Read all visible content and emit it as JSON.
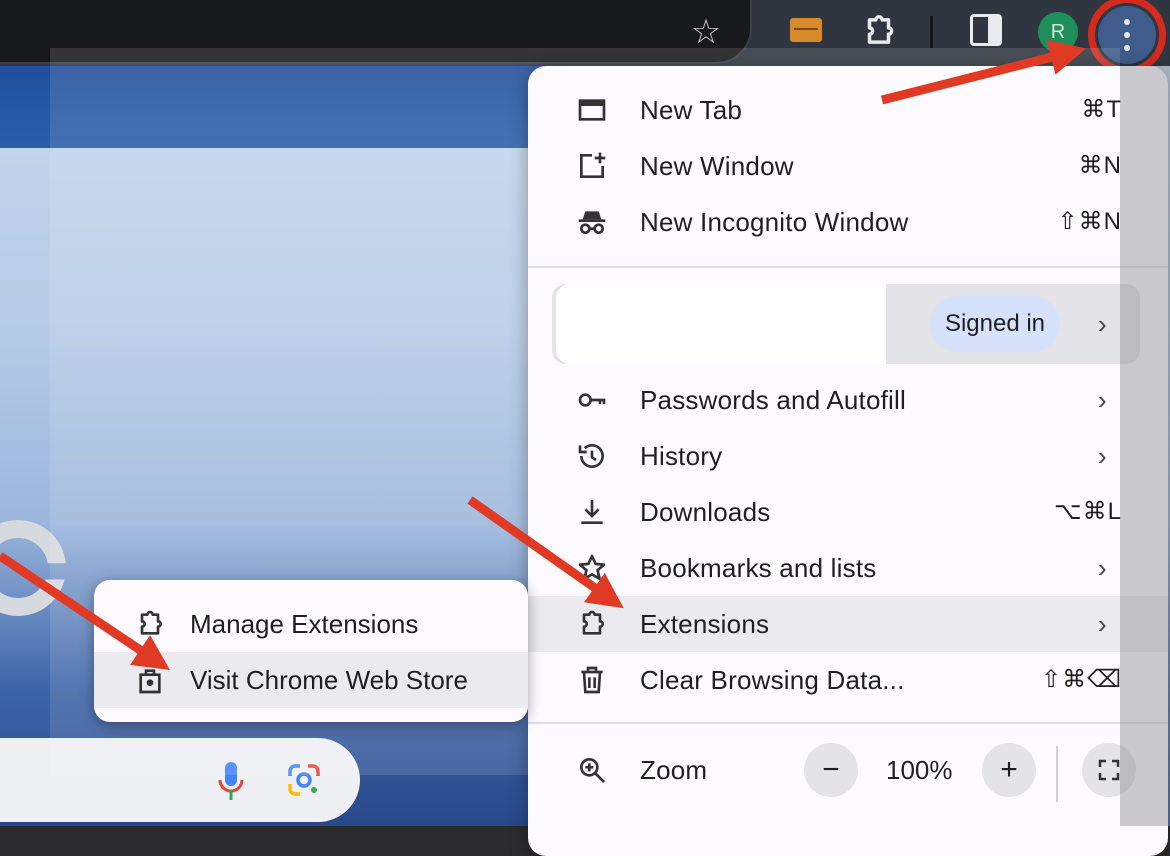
{
  "browser": {
    "avatar_initial": "R",
    "accent": "#d42b1e"
  },
  "menu": {
    "top_items": [
      {
        "label": "New Tab",
        "shortcut": "⌘T",
        "icon": "new-tab-icon"
      },
      {
        "label": "New Window",
        "shortcut": "⌘N",
        "icon": "new-window-icon"
      },
      {
        "label": "New Incognito Window",
        "shortcut": "⇧⌘N",
        "icon": "incognito-icon"
      }
    ],
    "profile": {
      "signed_in_label": "Signed in"
    },
    "items": [
      {
        "label": "Passwords and Autofill",
        "icon": "key-icon"
      },
      {
        "label": "History",
        "icon": "history-icon"
      },
      {
        "label": "Downloads",
        "shortcut": "⌥⌘L",
        "icon": "download-icon"
      },
      {
        "label": "Bookmarks and lists",
        "icon": "star-icon"
      },
      {
        "label": "Extensions",
        "icon": "puzzle-icon"
      },
      {
        "label": "Clear Browsing Data...",
        "shortcut": "⇧⌘⌫",
        "icon": "trash-icon"
      }
    ],
    "zoom": {
      "label": "Zoom",
      "value": "100%",
      "minus": "−",
      "plus": "+"
    },
    "chevron": "›"
  },
  "submenu": {
    "items": [
      {
        "label": "Manage Extensions",
        "icon": "puzzle-icon"
      },
      {
        "label": "Visit Chrome Web Store",
        "icon": "web-store-icon"
      }
    ]
  }
}
